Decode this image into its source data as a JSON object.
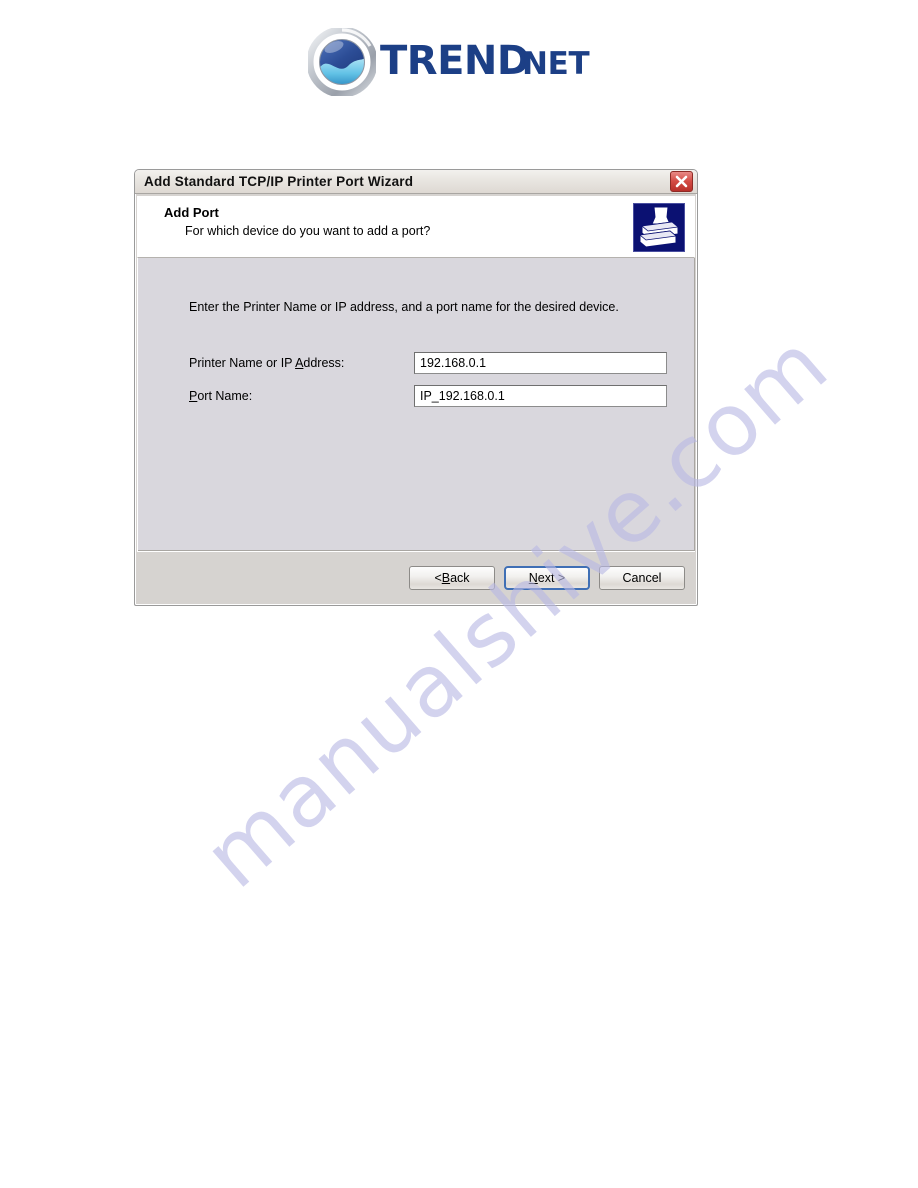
{
  "brand": {
    "logo_name": "trendnet-logo",
    "wordmark_primary": "TREND",
    "wordmark_secondary": "net",
    "wordmark_full": "TRENDnet",
    "colors": {
      "wordmark": "#1c3f86",
      "globe_top": "#2a4a93",
      "globe_wave": "#6cc8e8",
      "ring": "#b8bcc4"
    }
  },
  "dialog": {
    "titlebar": {
      "title": "Add Standard TCP/IP Printer Port Wizard",
      "close_label": "Close",
      "close_icon": "close-icon",
      "close_color": "#c9413a"
    },
    "header": {
      "title": "Add Port",
      "subtitle": "For which device do you want to add a port?",
      "icon": "printer-icon",
      "icon_bg": "#0b1172"
    },
    "content": {
      "instruction": "Enter the Printer Name or IP address, and a port name for the desired device.",
      "fields": [
        {
          "name": "printer-name-or-ip-address",
          "label_before": "Printer Name or IP ",
          "label_accesskey": "A",
          "label_after": "ddress:",
          "label_full": "Printer Name or IP Address:",
          "value": "192.168.0.1",
          "placeholder": ""
        },
        {
          "name": "port-name",
          "label_before": "",
          "label_accesskey": "P",
          "label_after": "ort Name:",
          "label_full": "Port Name:",
          "value": "IP_192.168.0.1",
          "placeholder": ""
        }
      ]
    },
    "footer": {
      "buttons": [
        {
          "name": "back-button",
          "prefix": "< ",
          "accesskey": "B",
          "suffix": "ack",
          "full": "< Back",
          "default": false
        },
        {
          "name": "next-button",
          "prefix": "",
          "accesskey": "N",
          "suffix": "ext >",
          "full": "Next >",
          "default": true
        },
        {
          "name": "cancel-button",
          "prefix": "",
          "accesskey": "",
          "suffix": "Cancel",
          "full": "Cancel",
          "default": false
        }
      ]
    }
  },
  "watermark": {
    "text": "manualshive.com",
    "color": "#b9b9e4"
  }
}
